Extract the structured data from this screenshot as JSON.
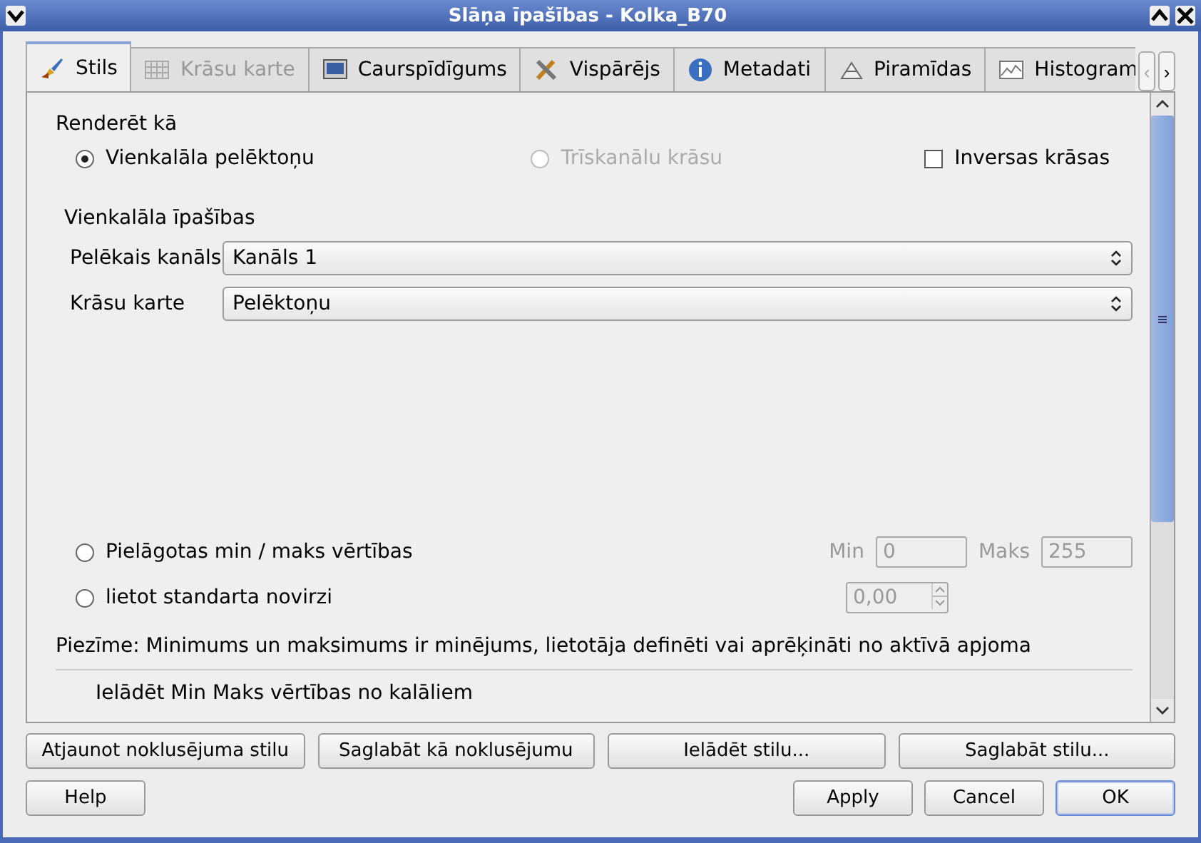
{
  "window": {
    "title": "Slāņa īpašības - Kolka_B70"
  },
  "tabs": [
    {
      "label": "Stils",
      "selected": true,
      "disabled": false
    },
    {
      "label": "Krāsu karte",
      "selected": false,
      "disabled": true
    },
    {
      "label": "Caurspīdīgums",
      "selected": false,
      "disabled": false
    },
    {
      "label": "Vispārējs",
      "selected": false,
      "disabled": false
    },
    {
      "label": "Metadati",
      "selected": false,
      "disabled": false
    },
    {
      "label": "Piramīdas",
      "selected": false,
      "disabled": false
    },
    {
      "label": "Histogram",
      "selected": false,
      "disabled": false
    }
  ],
  "tab_scroll": [
    {
      "label": "‹",
      "disabled": true
    },
    {
      "label": "›",
      "disabled": false
    }
  ],
  "render_as": {
    "label": "Renderēt kā",
    "options": [
      {
        "label": "Vienkalāla pelēktoņu",
        "selected": true,
        "disabled": false
      },
      {
        "label": "Trīskanālu krāsu",
        "selected": false,
        "disabled": true
      }
    ],
    "invert": {
      "label": "Inversas krāsas",
      "checked": false
    }
  },
  "single_band": {
    "title": "Vienkalāla īpašības",
    "rows": [
      {
        "label": "Pelēkais kanāls",
        "value": "Kanāls 1"
      },
      {
        "label": "Krāsu karte",
        "value": "Pelēktoņu"
      }
    ]
  },
  "minmax": [
    {
      "label": "Pielāgotas min / maks vērtības",
      "selected": false,
      "kind": "range",
      "fields": [
        {
          "label": "Min",
          "value": "0",
          "disabled": true
        },
        {
          "label": "Maks",
          "value": "255",
          "disabled": true
        }
      ]
    },
    {
      "label": "lietot standarta novirzi",
      "selected": false,
      "kind": "spin",
      "fields": [
        {
          "value": "0,00",
          "disabled": true
        }
      ]
    }
  ],
  "note": "Piezīme: Minimums un maksimums ir minējums, lietotāja definēti vai aprēķināti no aktīvā apjoma",
  "load_section": {
    "title": "Ielādēt Min Maks vērtības no kalāliem"
  },
  "style_buttons": [
    "Atjaunot noklusējuma stilu",
    "Saglabāt kā noklusējumu",
    "Ielādēt stilu...",
    "Saglabāt stilu..."
  ],
  "help_button": "Help",
  "dialog_buttons": [
    {
      "label": "Apply",
      "default": false
    },
    {
      "label": "Cancel",
      "default": false
    },
    {
      "label": "OK",
      "default": true
    }
  ]
}
